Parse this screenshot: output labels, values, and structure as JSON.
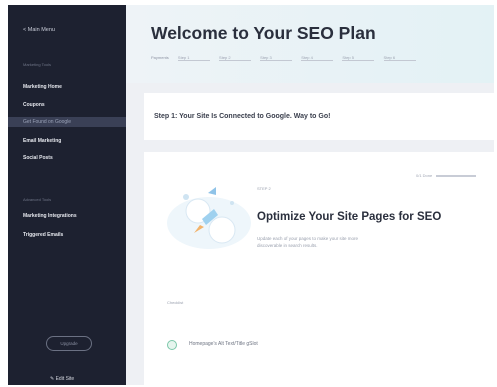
{
  "sidebar": {
    "back_label": "< Main Menu",
    "section1": "Marketing Tools",
    "items1": [
      "Marketing Home",
      "Coupons",
      "Get Found on Google",
      "Email Marketing",
      "Social Posts"
    ],
    "section2": "Advanced Tools",
    "items2": [
      "Marketing Integrations",
      "Triggered Emails"
    ],
    "upgrade_label": "Upgrade",
    "edit_label": "Edit Site"
  },
  "main": {
    "title": "Welcome to Your SEO Plan",
    "steps_label": "Payments",
    "step_tabs": [
      "Step 1",
      "Step 2",
      "Step 3",
      "Step 4",
      "Step 5",
      "Step 6"
    ],
    "step1_text": "Step 1: Your Site Is Connected to Google. Way to Go!",
    "step2": {
      "label": "STEP 2",
      "title": "Optimize Your Site Pages for SEO",
      "description": "Update each of your pages to make your site more discoverable in search results.",
      "progress_label": "0/1 Done",
      "progress": 0,
      "list_header": "Checklist",
      "items": [
        "Homepage's Alt Text/Title gSlot"
      ]
    }
  },
  "colors": {
    "sidebar": "#1d2130",
    "accent": "#3a4056",
    "check": "#7bc7a9"
  }
}
